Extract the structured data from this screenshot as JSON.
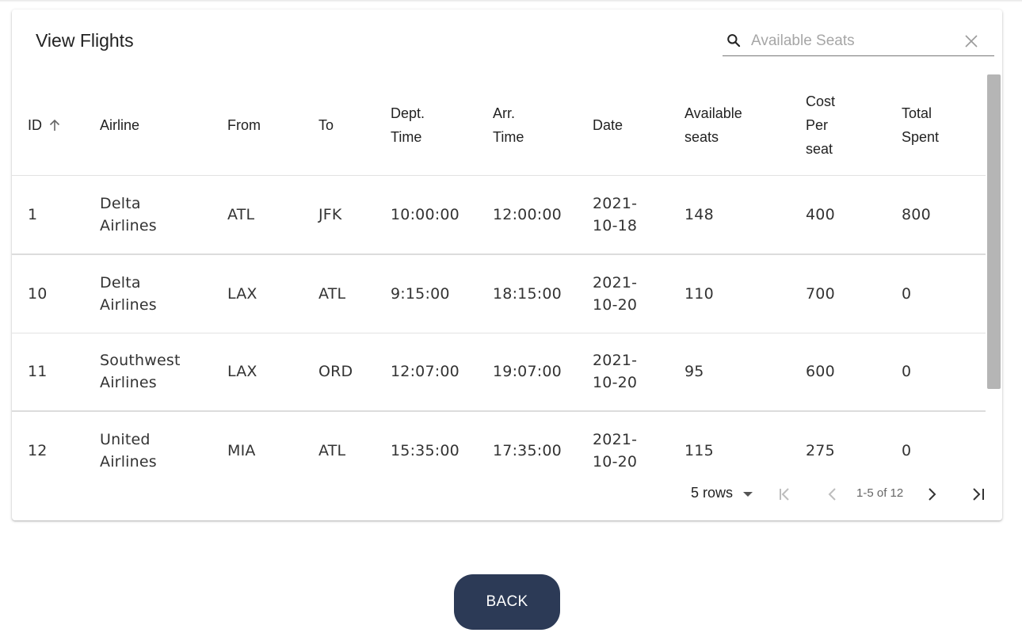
{
  "title": "View Flights",
  "search": {
    "placeholder": "Available Seats",
    "value": ""
  },
  "columns": {
    "id": "ID",
    "airline": "Airline",
    "from": "From",
    "to": "To",
    "dept_1": "Dept.",
    "dept_2": "Time",
    "arr_1": "Arr.",
    "arr_2": "Time",
    "date": "Date",
    "avail_1": "Available",
    "avail_2": "seats",
    "cost_1": "Cost",
    "cost_2": "Per",
    "cost_3": "seat",
    "total_1": "Total",
    "total_2": "Spent"
  },
  "rows": [
    {
      "id": "1",
      "airline_1": "Delta",
      "airline_2": "Airlines",
      "from": "ATL",
      "to": "JFK",
      "dept": "10:00:00",
      "arr": "12:00:00",
      "date_1": "2021-",
      "date_2": "10-18",
      "available": "148",
      "cost": "400",
      "total": "800"
    },
    {
      "id": "10",
      "airline_1": "Delta",
      "airline_2": "Airlines",
      "from": "LAX",
      "to": "ATL",
      "dept": "9:15:00",
      "arr": "18:15:00",
      "date_1": "2021-",
      "date_2": "10-20",
      "available": "110",
      "cost": "700",
      "total": "0"
    },
    {
      "id": "11",
      "airline_1": "Southwest",
      "airline_2": "Airlines",
      "from": "LAX",
      "to": "ORD",
      "dept": "12:07:00",
      "arr": "19:07:00",
      "date_1": "2021-",
      "date_2": "10-20",
      "available": "95",
      "cost": "600",
      "total": "0"
    },
    {
      "id": "12",
      "airline_1": "United",
      "airline_2": "Airlines",
      "from": "MIA",
      "to": "ATL",
      "dept": "15:35:00",
      "arr": "17:35:00",
      "date_1": "2021-",
      "date_2": "10-20",
      "available": "115",
      "cost": "275",
      "total": "0"
    }
  ],
  "pagination": {
    "rows_per_page": "5 rows",
    "range": "1-5 of 12"
  },
  "back_label": "BACK",
  "colors": {
    "button_bg": "#2c3a56",
    "scrollbar": "#b5b5b5"
  }
}
